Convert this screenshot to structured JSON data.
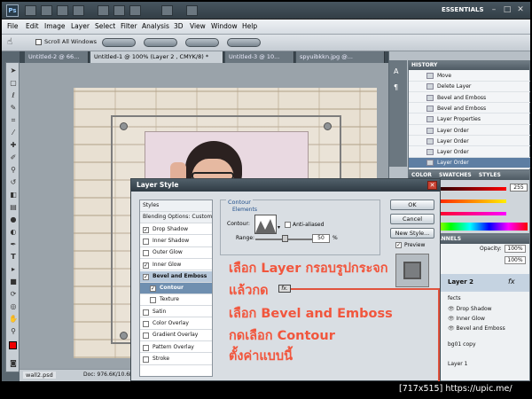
{
  "app": {
    "logo": "Ps",
    "workspace": "ESSENTIALS",
    "window_buttons": [
      "–",
      "□",
      "✕"
    ]
  },
  "menu": [
    "File",
    "Edit",
    "Image",
    "Layer",
    "Select",
    "Filter",
    "Analysis",
    "3D",
    "View",
    "Window",
    "Help"
  ],
  "options_bar": {
    "scroll_all_windows": "Scroll All Windows"
  },
  "tabs": [
    {
      "label": "Untitled-2 @ 66...",
      "active": false
    },
    {
      "label": "Untitled-1 @ 100% (Layer 2 , CMYK/8) *",
      "active": true
    },
    {
      "label": "Untitled-3 @ 10...",
      "active": false
    },
    {
      "label": "spyuibkkn.jpg @...",
      "active": false
    }
  ],
  "history": {
    "title": "HISTORY",
    "items": [
      "Move",
      "Delete Layer",
      "Bevel and Emboss",
      "Bevel and Emboss",
      "Layer Properties",
      "Layer Order",
      "Layer Order",
      "Layer Order",
      "Layer Order"
    ],
    "active_index": 8
  },
  "color_panel": {
    "tabs": [
      "COLOR",
      "SWATCHES",
      "STYLES"
    ],
    "value": "255"
  },
  "layers_panel": {
    "header": "ATHS  CHANNELS",
    "opacity_label": "Opacity:",
    "opacity_value": "100%",
    "fill_value": "100%",
    "layer_name": "Layer 2",
    "effects_label": "fects",
    "effects": [
      "Drop Shadow",
      "Inner Glow",
      "Bevel and Emboss"
    ],
    "other_layers": [
      "bg01 copy",
      "Layer 1"
    ]
  },
  "status": {
    "file_tab": "wall2.psd",
    "doc": "Doc: 976.6K/10.6M"
  },
  "dialog": {
    "title": "Layer Style",
    "list": [
      {
        "label": "Styles",
        "kind": "head",
        "checked": ""
      },
      {
        "label": "Blending Options: Custom",
        "kind": "head",
        "checked": ""
      },
      {
        "label": "Drop Shadow",
        "kind": "item",
        "checked": "✓"
      },
      {
        "label": "Inner Shadow",
        "kind": "item",
        "checked": ""
      },
      {
        "label": "Outer Glow",
        "kind": "item",
        "checked": ""
      },
      {
        "label": "Inner Glow",
        "kind": "item",
        "checked": "✓"
      },
      {
        "label": "Bevel and Emboss",
        "kind": "sel",
        "checked": "✓"
      },
      {
        "label": "Contour",
        "kind": "subsel",
        "checked": "✓"
      },
      {
        "label": "Texture",
        "kind": "sub",
        "checked": ""
      },
      {
        "label": "Satin",
        "kind": "item",
        "checked": ""
      },
      {
        "label": "Color Overlay",
        "kind": "item",
        "checked": ""
      },
      {
        "label": "Gradient Overlay",
        "kind": "item",
        "checked": ""
      },
      {
        "label": "Pattern Overlay",
        "kind": "item",
        "checked": ""
      },
      {
        "label": "Stroke",
        "kind": "item",
        "checked": ""
      }
    ],
    "section_title": "Contour",
    "elements_title": "Elements",
    "contour_label": "Contour:",
    "anti_aliased": "Anti-aliased",
    "range_label": "Range:",
    "range_value": "50",
    "range_unit": "%",
    "buttons": {
      "ok": "OK",
      "cancel": "Cancel",
      "new_style": "New Style..."
    },
    "preview_label": "Preview"
  },
  "annotation": {
    "line1": "เลือก Layer กรอบรูปกระจก",
    "line2": "แล้วกด",
    "fx": "fx.",
    "line3": "เลือก Bevel and Emboss",
    "line4": "กดเลือก Contour",
    "line5": "ตั้งค่าแบบนี้"
  },
  "watermark": "[717x515] https://upic.me/"
}
